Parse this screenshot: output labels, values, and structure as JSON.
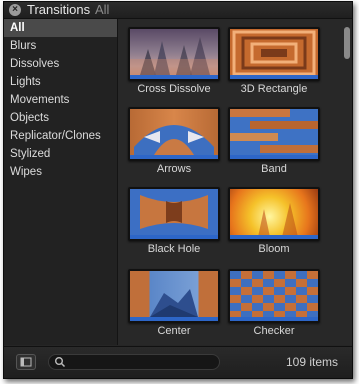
{
  "header": {
    "title": "Transitions",
    "filter": "All",
    "close_icon": "close-icon"
  },
  "sidebar": {
    "items": [
      {
        "label": "All",
        "selected": true
      },
      {
        "label": "Blurs"
      },
      {
        "label": "Dissolves"
      },
      {
        "label": "Lights"
      },
      {
        "label": "Movements"
      },
      {
        "label": "Objects"
      },
      {
        "label": "Replicator/Clones"
      },
      {
        "label": "Stylized"
      },
      {
        "label": "Wipes"
      }
    ]
  },
  "grid": {
    "items": [
      {
        "label": "Cross Dissolve"
      },
      {
        "label": "3D Rectangle"
      },
      {
        "label": "Arrows"
      },
      {
        "label": "Band"
      },
      {
        "label": "Black Hole"
      },
      {
        "label": "Bloom"
      },
      {
        "label": "Center"
      },
      {
        "label": "Checker"
      }
    ]
  },
  "footer": {
    "count": "109 items",
    "search_icon": "search-icon",
    "toggle_icon": "sidebar-toggle-icon"
  },
  "colors": {
    "accent": "#2d66c8",
    "panel": "#262626",
    "selected": "#4a4a4a"
  }
}
